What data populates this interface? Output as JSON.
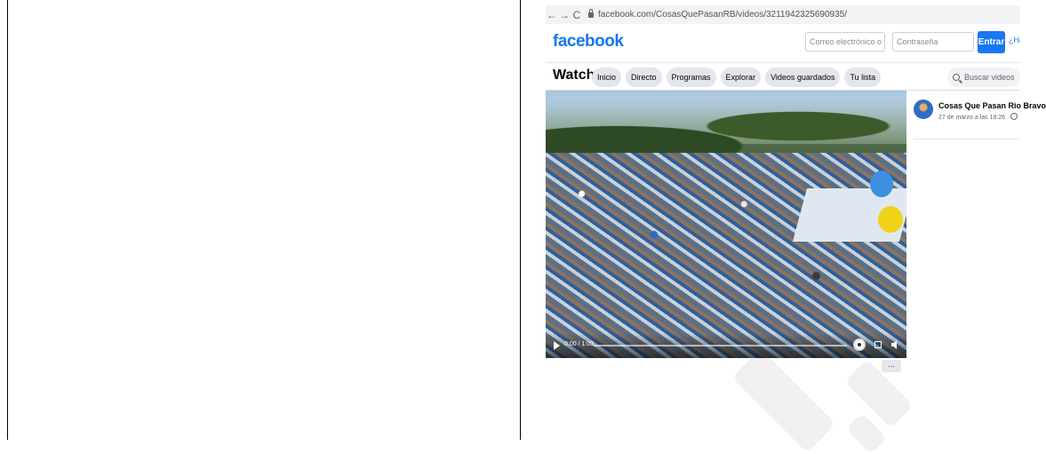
{
  "browser": {
    "url": "facebook.com/CosasQuePasanRB/videos/3211942325690935/",
    "back_icon": "←",
    "forward_icon": "→",
    "reload_icon": "C"
  },
  "header": {
    "logo": "facebook",
    "email_placeholder": "Correo electrónico o telé",
    "password_placeholder": "Contraseña",
    "login_label": "Entrar",
    "forgot_label": "¿Ha"
  },
  "watch": {
    "title": "Watch",
    "tabs": [
      "Inicio",
      "Directo",
      "Programas",
      "Explorar",
      "Videos guardados",
      "Tu lista"
    ],
    "search_placeholder": "Buscar videos"
  },
  "video": {
    "time": "0:00 / 1:03",
    "progress": 0
  },
  "post": {
    "author": "Cosas Que Pasan Rio Bravo",
    "date": "27 de marzo a las 18:26 ·"
  },
  "more_label": "..."
}
